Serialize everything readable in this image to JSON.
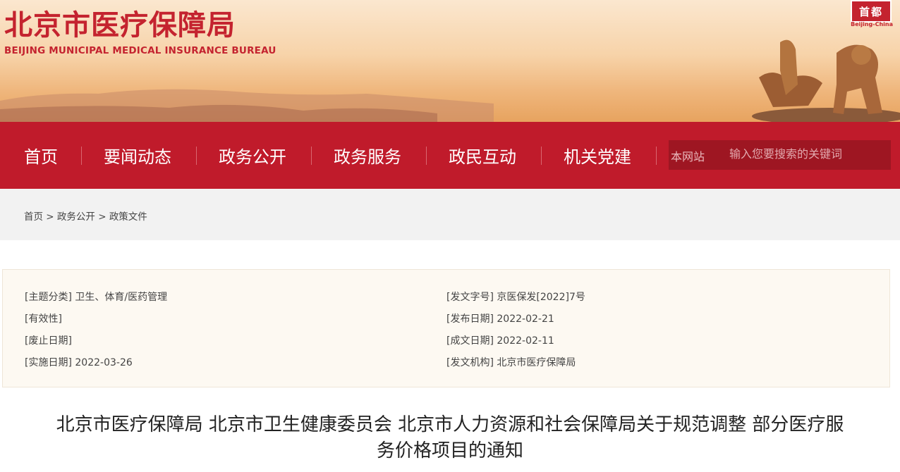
{
  "header": {
    "logo_cn": "北京市医疗保障局",
    "logo_en": "BEIJING MUNICIPAL MEDICAL INSURANCE BUREAU",
    "seal_text": "首都",
    "seal_en": "Beijing-China"
  },
  "nav": {
    "items": [
      {
        "label": "首页"
      },
      {
        "label": "要闻动态"
      },
      {
        "label": "政务公开"
      },
      {
        "label": "政务服务"
      },
      {
        "label": "政民互动"
      },
      {
        "label": "机关党建"
      }
    ],
    "search": {
      "scope": "本网站",
      "placeholder": "输入您要搜索的关键词"
    }
  },
  "breadcrumb": {
    "items": [
      "首页",
      "政务公开",
      "政策文件"
    ],
    "separator": " > "
  },
  "meta": {
    "subject_key": "[主题分类]",
    "subject_val": "卫生、体育/医药管理",
    "validity_key": "[有效性]",
    "validity_val": "",
    "repeal_key": "[废止日期]",
    "repeal_val": "",
    "effective_key": "[实施日期]",
    "effective_val": "2022-03-26",
    "docno_key": "[发文字号]",
    "docno_val": "京医保发[2022]7号",
    "publish_key": "[发布日期]",
    "publish_val": "2022-02-21",
    "created_key": "[成文日期]",
    "created_val": "2022-02-11",
    "issuer_key": "[发文机构]",
    "issuer_val": "北京市医疗保障局"
  },
  "article": {
    "title_line1": "北京市医疗保障局 北京市卫生健康委员会 北京市人力资源和社会保障局关于规范调整 部分医疗服",
    "title_line2": "务价格项目的通知"
  },
  "colors": {
    "brand_red": "#c01b2b",
    "banner_peach": "#f7d3a9",
    "meta_bg": "#fdf9f2"
  }
}
